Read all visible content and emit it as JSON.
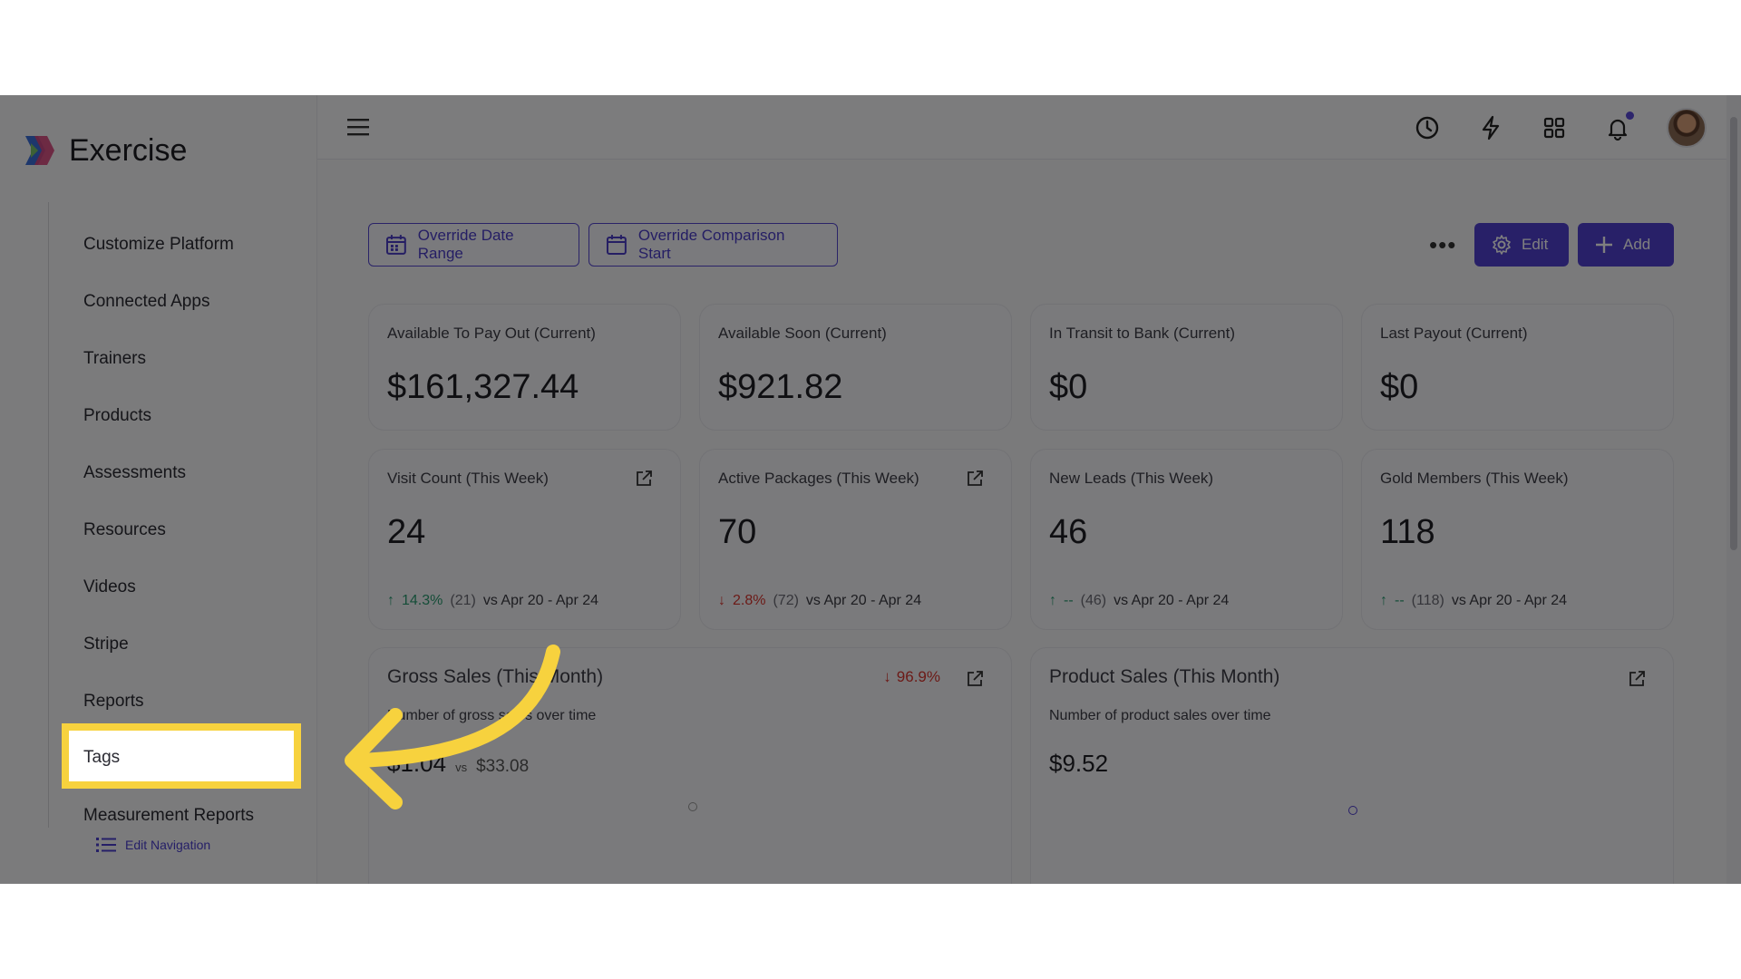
{
  "app": {
    "name": "Exercise"
  },
  "sidebar": {
    "items": [
      {
        "label": "Customize Platform"
      },
      {
        "label": "Connected Apps"
      },
      {
        "label": "Trainers"
      },
      {
        "label": "Products"
      },
      {
        "label": "Assessments"
      },
      {
        "label": "Resources"
      },
      {
        "label": "Videos"
      },
      {
        "label": "Stripe"
      },
      {
        "label": "Reports"
      },
      {
        "label": "Tags"
      },
      {
        "label": "Measurement Reports"
      }
    ],
    "edit_navigation_label": "Edit Navigation"
  },
  "toolbar": {
    "override_date_range": "Override Date Range",
    "override_comparison_start": "Override Comparison Start",
    "more": "•••",
    "edit": "Edit",
    "add": "Add"
  },
  "cards_row1": [
    {
      "title": "Available To Pay Out (Current)",
      "value": "$161,327.44"
    },
    {
      "title": "Available Soon (Current)",
      "value": "$921.82"
    },
    {
      "title": "In Transit to Bank (Current)",
      "value": "$0"
    },
    {
      "title": "Last Payout (Current)",
      "value": "$0"
    }
  ],
  "cards_row2": [
    {
      "title": "Visit Count (This Week)",
      "value": "24",
      "change": "14.3%",
      "previous": "(21)",
      "comparison": "vs Apr 20 - Apr 24",
      "direction": "up"
    },
    {
      "title": "Active Packages (This Week)",
      "value": "70",
      "change": "2.8%",
      "previous": "(72)",
      "comparison": "vs Apr 20 - Apr 24",
      "direction": "down"
    },
    {
      "title": "New Leads (This Week)",
      "value": "46",
      "change": "--",
      "previous": "(46)",
      "comparison": "vs Apr 20 - Apr 24",
      "direction": "up"
    },
    {
      "title": "Gold Members (This Week)",
      "value": "118",
      "change": "--",
      "previous": "(118)",
      "comparison": "vs Apr 20 - Apr 24",
      "direction": "up"
    }
  ],
  "gross_sales": {
    "title": "Gross Sales (This Month)",
    "change": "96.9%",
    "subtitle": "Number of gross sales over time",
    "value": "$1.04",
    "vs_label": "vs",
    "comparison_value": "$33.08"
  },
  "product_sales": {
    "title": "Product Sales (This Month)",
    "subtitle": "Number of product sales over time",
    "value": "$9.52"
  },
  "colors": {
    "accent": "#5140d1",
    "highlight": "#f7d23e",
    "up": "#2a9a71",
    "down": "#d8352f"
  }
}
